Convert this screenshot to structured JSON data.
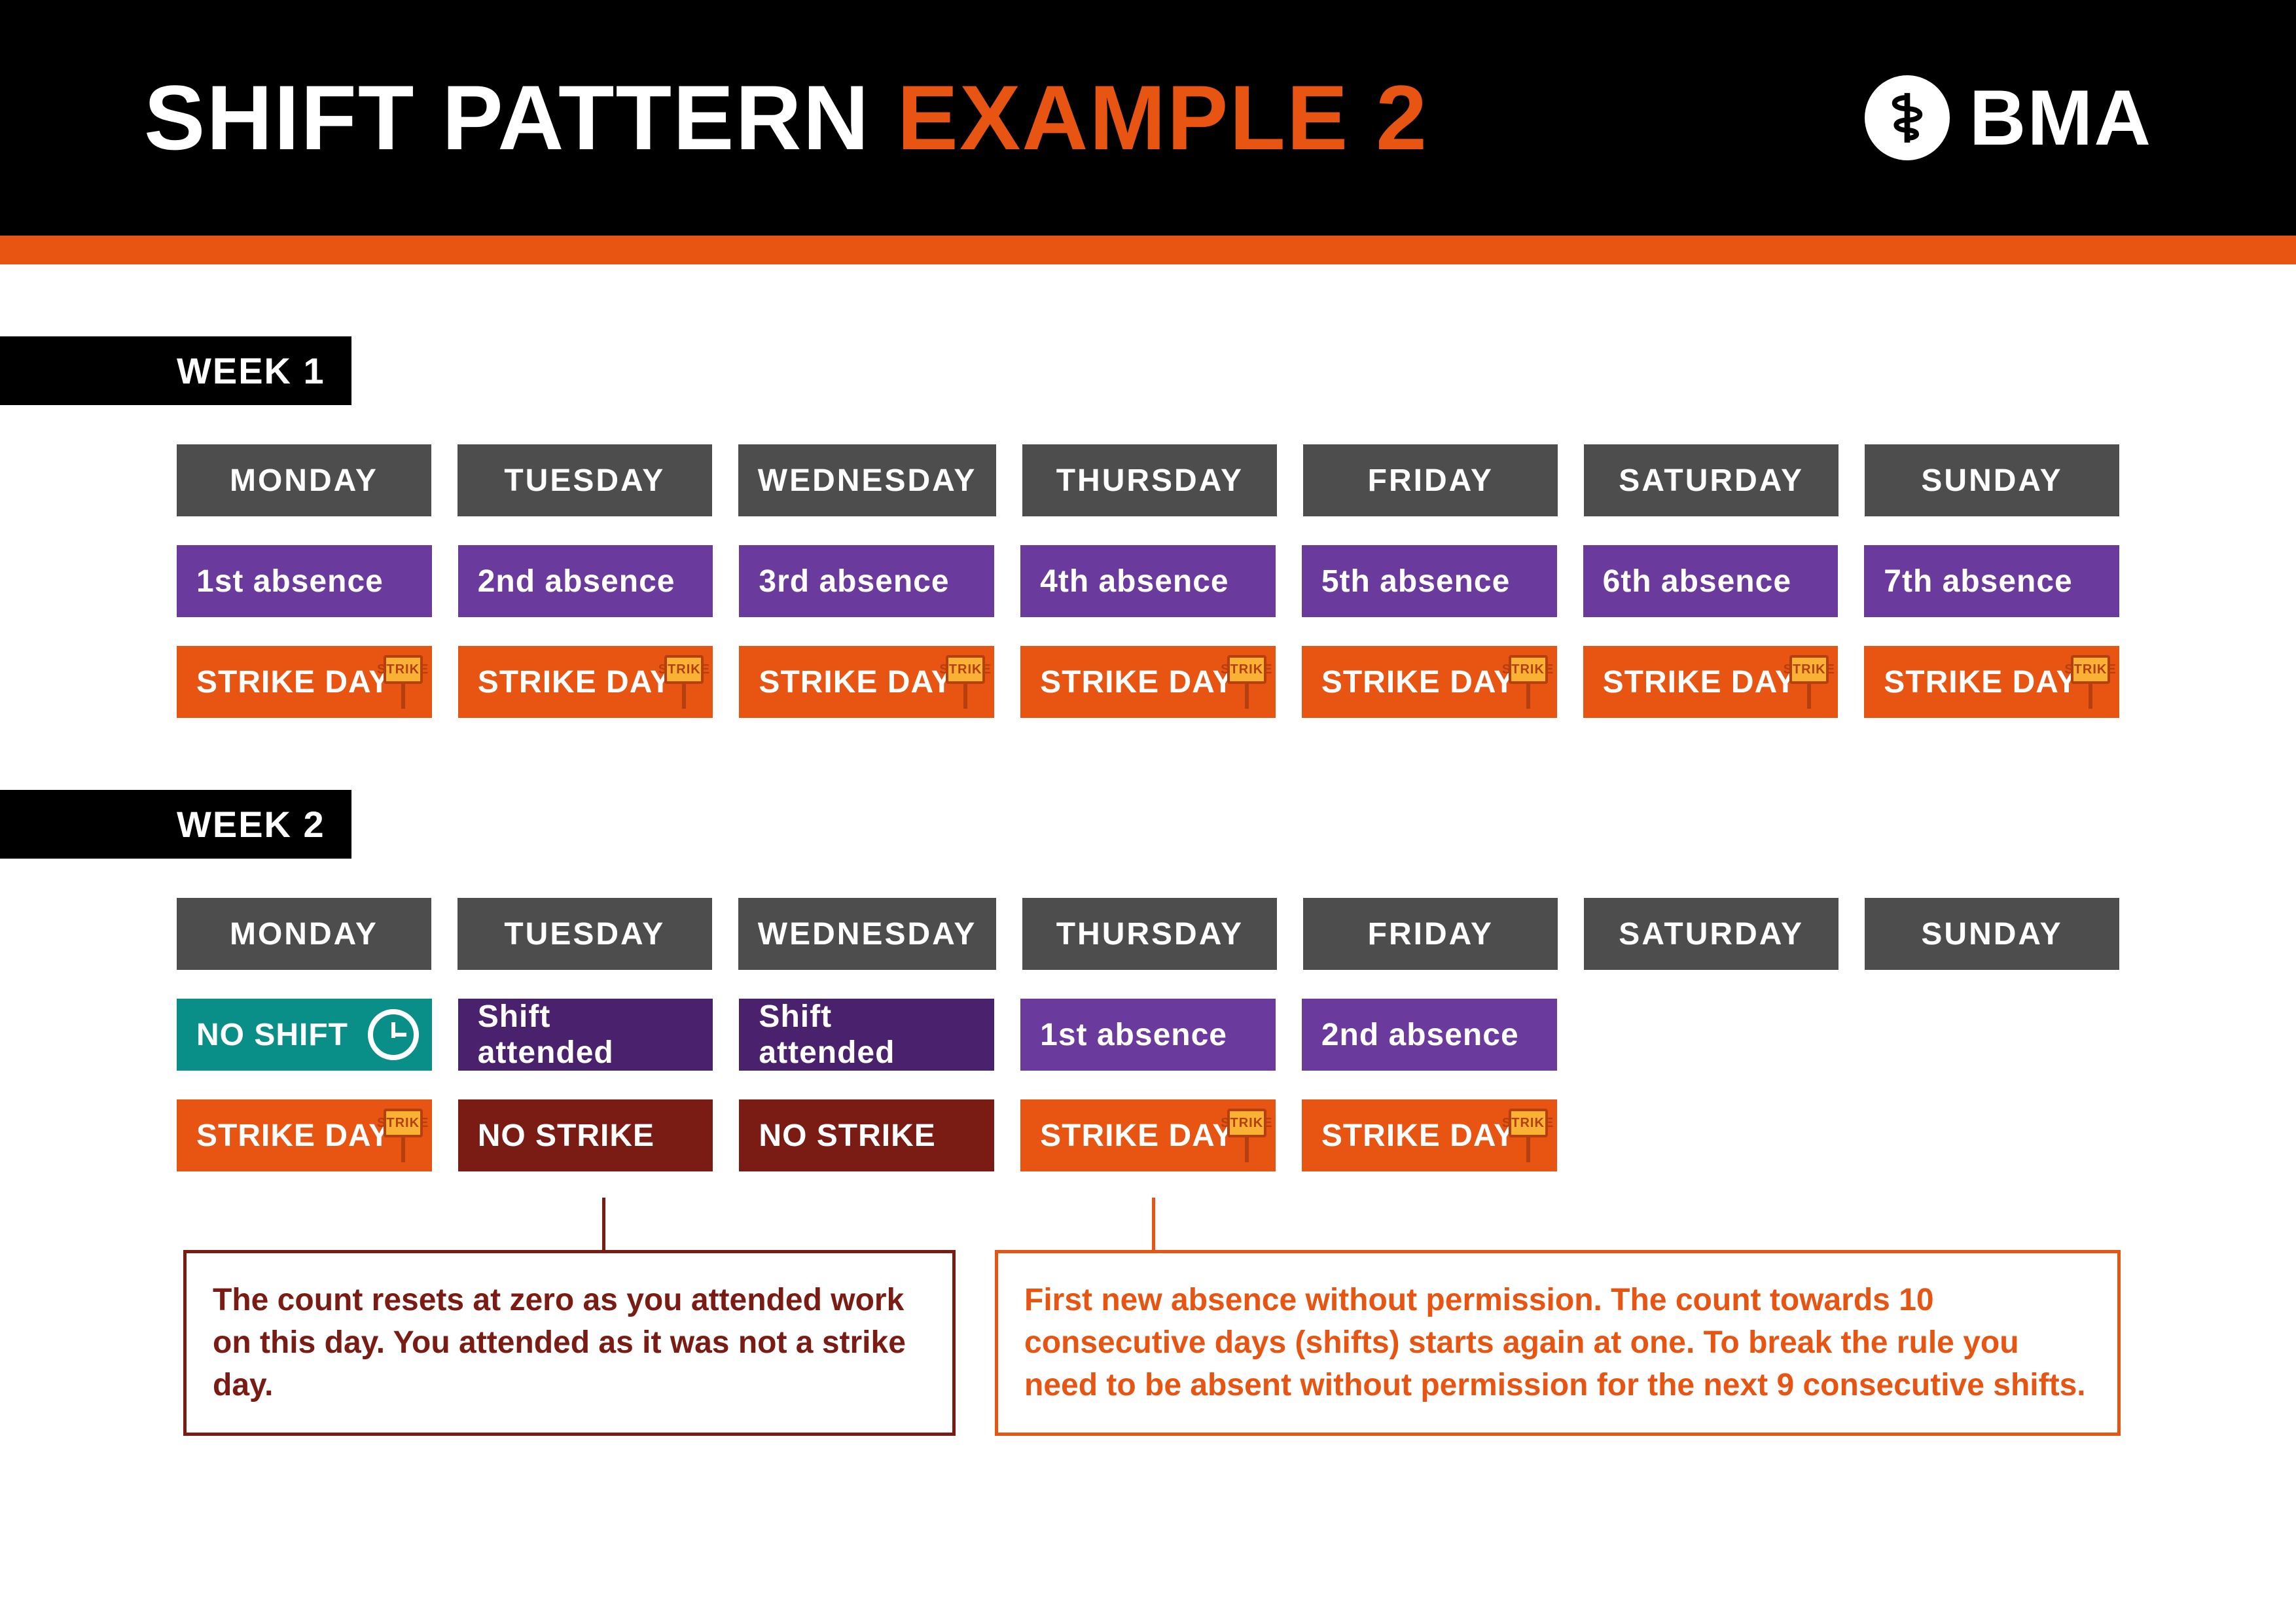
{
  "colors": {
    "black": "#000000",
    "orange": "#e85412",
    "grey": "#4d4d4d",
    "purple": "#6a3a9c",
    "darkpurple": "#4a216d",
    "teal": "#0a8f88",
    "maroon": "#7a1b14",
    "white": "#ffffff"
  },
  "header": {
    "title_part1": "SHIFT PATTERN ",
    "title_part2": "EXAMPLE 2",
    "logo_text": "BMA",
    "logo_icon": "bma-staff-icon"
  },
  "days": [
    "MONDAY",
    "TUESDAY",
    "WEDNESDAY",
    "THURSDAY",
    "FRIDAY",
    "SATURDAY",
    "SUNDAY"
  ],
  "labels": {
    "strike_day": "STRIKE DAY",
    "no_strike": "NO STRIKE",
    "no_shift": "NO SHIFT",
    "shift_attended": "Shift attended",
    "strike_sign": "STRIKE"
  },
  "week1": {
    "label": "WEEK 1",
    "absences": [
      "1st absence",
      "2nd absence",
      "3rd absence",
      "4th absence",
      "5th absence",
      "6th absence",
      "7th absence"
    ]
  },
  "week2": {
    "label": "WEEK 2",
    "row_status": [
      {
        "type": "noshift"
      },
      {
        "type": "attended"
      },
      {
        "type": "attended"
      },
      {
        "type": "absence",
        "text": "1st absence"
      },
      {
        "type": "absence",
        "text": "2nd absence"
      }
    ],
    "row_strike": [
      "strike",
      "nostrike",
      "nostrike",
      "strike",
      "strike"
    ]
  },
  "callouts": {
    "left": "The count resets at zero as you attended work on this day. You attended as it was not a strike day.",
    "right": "First new absence without permission. The count towards 10 consecutive days (shifts) starts again at one. To break the rule you need to be absent without permission for the next 9 consecutive shifts."
  }
}
